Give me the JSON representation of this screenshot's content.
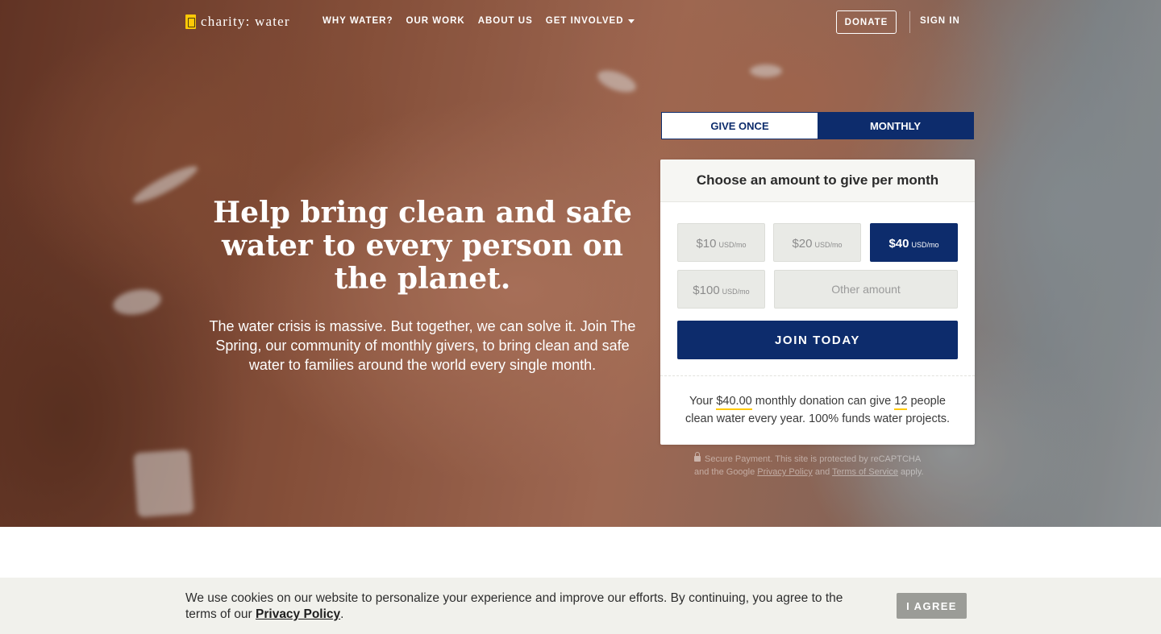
{
  "brand": {
    "name": "charity: water",
    "logo_icon": "jerry-can-icon",
    "accent_color": "#ffc907",
    "primary_color": "#0d2c6c"
  },
  "nav": {
    "links": [
      "WHY WATER?",
      "OUR WORK",
      "ABOUT US",
      "GET INVOLVED"
    ],
    "donate_label": "DONATE",
    "signin_label": "SIGN IN"
  },
  "hero": {
    "headline": "Help bring clean and safe water to every person on the planet.",
    "subtext": "The water crisis is massive. But together, we can solve it. Join The Spring, our community of monthly givers, to bring clean and safe water to families around the world every single month."
  },
  "donation": {
    "tabs": {
      "once": "GIVE ONCE",
      "monthly": "MONTHLY",
      "active": "monthly"
    },
    "heading": "Choose an amount to give per month",
    "amounts": [
      {
        "value": "$10",
        "unit": "USD/mo",
        "selected": false
      },
      {
        "value": "$20",
        "unit": "USD/mo",
        "selected": false
      },
      {
        "value": "$40",
        "unit": "USD/mo",
        "selected": true
      },
      {
        "value": "$100",
        "unit": "USD/mo",
        "selected": false
      }
    ],
    "other_placeholder": "Other amount",
    "join_label": "JOIN TODAY",
    "impact": {
      "prefix": "Your",
      "amount": "$40.00",
      "middle": "monthly donation can give",
      "people": "12",
      "suffix": "people clean water every year. 100% funds water projects."
    }
  },
  "secure_note": {
    "line1": "Secure Payment. This site is protected by reCAPTCHA",
    "line2_prefix": "and the Google",
    "privacy_link": "Privacy Policy",
    "line2_and": "and",
    "terms_link": "Terms of Service",
    "line2_suffix": "apply."
  },
  "cookie": {
    "text": "We use cookies on our website to personalize your experience and improve our efforts. By continuing, you agree to the terms of our",
    "link": "Privacy Policy",
    "period": ".",
    "agree_label": "I AGREE"
  }
}
